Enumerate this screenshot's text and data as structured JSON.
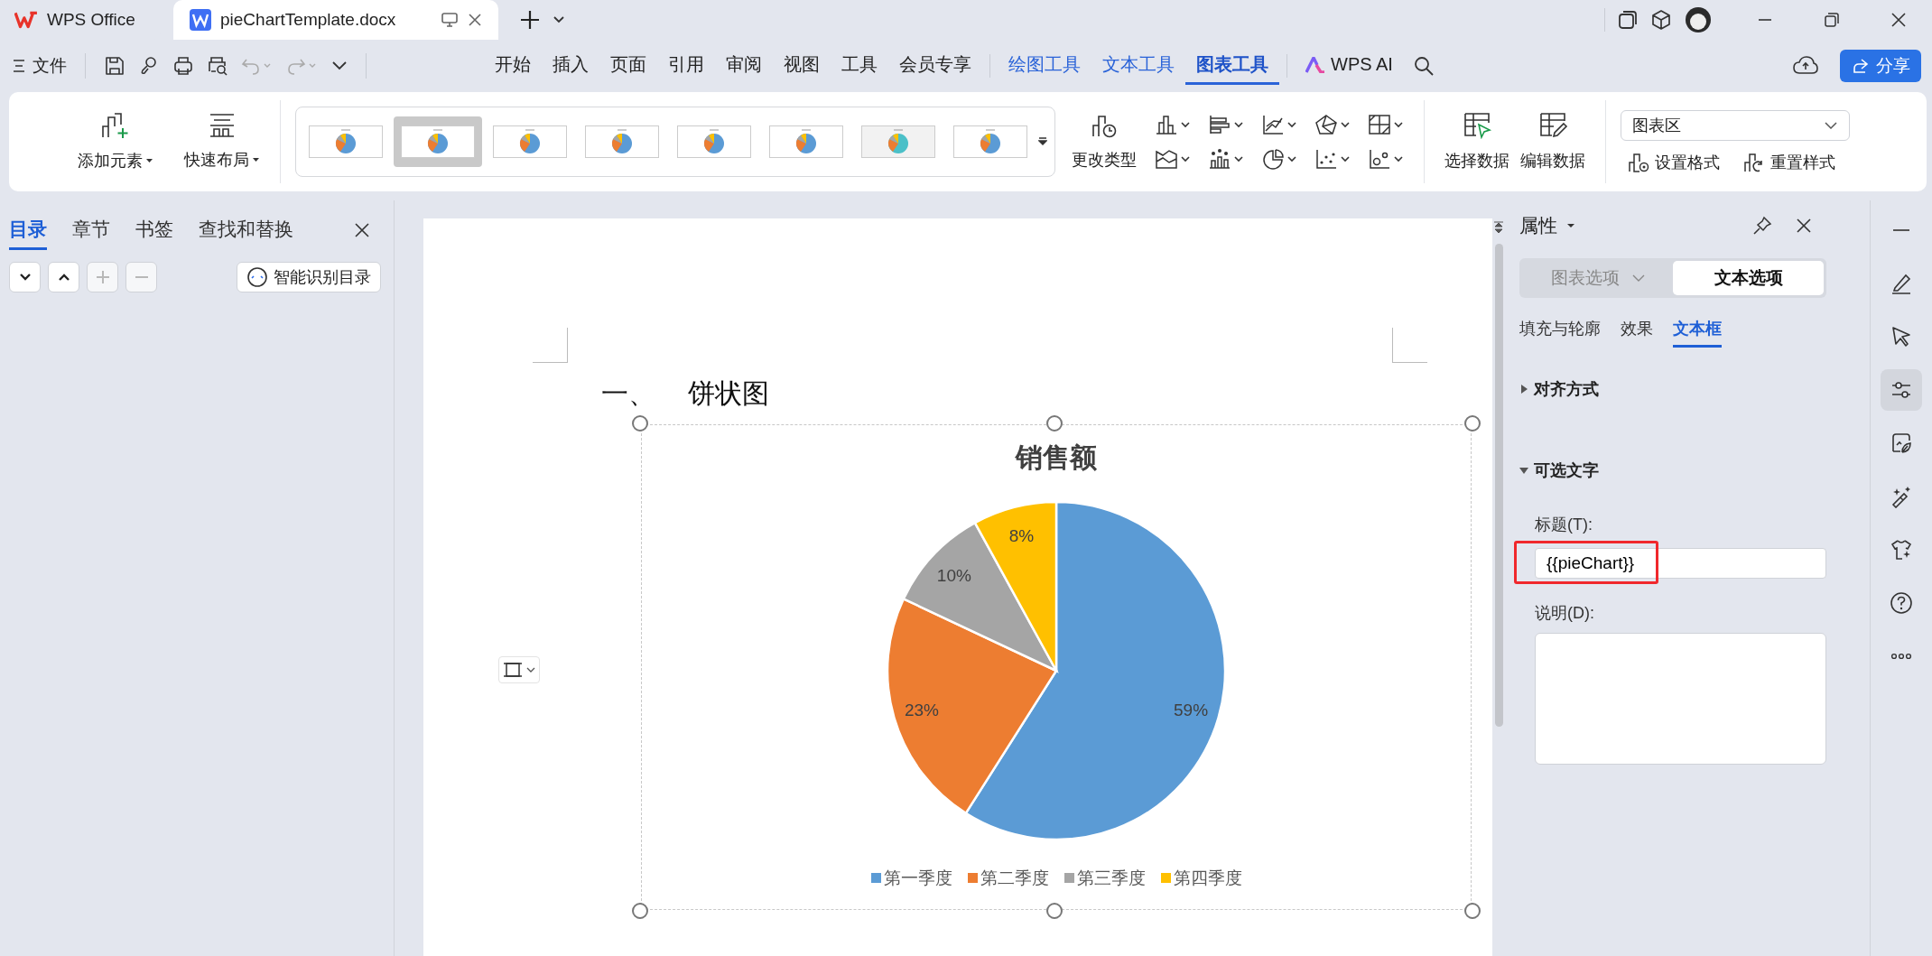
{
  "title_bar": {
    "tabs": [
      {
        "label": "WPS Office",
        "kind": "home",
        "selected": false
      },
      {
        "label": "pieChartTemplate.docx",
        "kind": "document",
        "selected": true
      }
    ]
  },
  "menu_bar": {
    "file_label": "文件",
    "items": [
      {
        "label": "开始",
        "kind": "main",
        "selected": false
      },
      {
        "label": "插入",
        "kind": "main",
        "selected": false
      },
      {
        "label": "页面",
        "kind": "main",
        "selected": false
      },
      {
        "label": "引用",
        "kind": "main",
        "selected": false
      },
      {
        "label": "审阅",
        "kind": "main",
        "selected": false
      },
      {
        "label": "视图",
        "kind": "main",
        "selected": false
      },
      {
        "label": "工具",
        "kind": "main",
        "selected": false
      },
      {
        "label": "会员专享",
        "kind": "main",
        "selected": false
      },
      {
        "label": "绘图工具",
        "kind": "tool",
        "selected": false
      },
      {
        "label": "文本工具",
        "kind": "tool",
        "selected": false
      },
      {
        "label": "图表工具",
        "kind": "tool",
        "selected": true
      },
      {
        "label": "WPS AI",
        "kind": "ai",
        "selected": false
      }
    ],
    "share_label": "分享"
  },
  "ribbon": {
    "layout_buttons": [
      {
        "label": "添加元素",
        "kind": "add"
      },
      {
        "label": "快速布局",
        "kind": "layout"
      }
    ],
    "chart_styles": [
      {
        "selected": false
      },
      {
        "selected": true
      },
      {
        "selected": false
      },
      {
        "selected": false
      },
      {
        "selected": false
      },
      {
        "selected": false
      },
      {
        "selected": false
      },
      {
        "selected": false
      }
    ],
    "change_type_label": "更改类型",
    "data_buttons": [
      {
        "label": "选择数据",
        "kind": "select"
      },
      {
        "label": "编辑数据",
        "kind": "edit"
      }
    ],
    "element_select": {
      "value": "图表区"
    },
    "format_buttons": [
      {
        "label": "设置格式",
        "kind": "format"
      },
      {
        "label": "重置样式",
        "kind": "reset"
      }
    ]
  },
  "left_panel": {
    "tabs": [
      {
        "label": "目录",
        "selected": true
      },
      {
        "label": "章节",
        "selected": false
      },
      {
        "label": "书签",
        "selected": false
      },
      {
        "label": "查找和替换",
        "selected": false
      }
    ],
    "nav_buttons": [
      {
        "kind": "down",
        "disabled": false
      },
      {
        "kind": "up",
        "disabled": false
      },
      {
        "kind": "add",
        "disabled": true
      },
      {
        "kind": "remove",
        "disabled": true
      }
    ],
    "smart_toc_label": "智能识别目录"
  },
  "document": {
    "heading_number": "一、",
    "heading": "饼状图",
    "chart_data": {
      "type": "pie",
      "title": "销售额",
      "categories": [
        "第一季度",
        "第二季度",
        "第三季度",
        "第四季度"
      ],
      "values": [
        59,
        23,
        10,
        8
      ],
      "legend": "bottom",
      "colors": [
        "#5b9bd5",
        "#ed7d31",
        "#a5a5a5",
        "#ffc000"
      ],
      "value_labels": [
        "59%",
        "23%",
        "10%",
        "8%"
      ]
    }
  },
  "properties_panel": {
    "title": "属性",
    "option_tabs": [
      {
        "label": "图表选项",
        "selected": false
      },
      {
        "label": "文本选项",
        "selected": true
      }
    ],
    "sub_tabs": [
      {
        "label": "填充与轮廓",
        "selected": false
      },
      {
        "label": "效果",
        "selected": false
      },
      {
        "label": "文本框",
        "selected": true
      }
    ],
    "sections": [
      {
        "title": "对齐方式",
        "expanded": false
      },
      {
        "title": "可选文字",
        "expanded": true
      }
    ],
    "alt_title_label": "标题(T):",
    "alt_title_value": "{{pieChart}}",
    "alt_description_label": "说明(D):"
  },
  "side_toolbar": {
    "items": [
      {
        "kind": "minimize",
        "selected": false
      },
      {
        "kind": "pen",
        "selected": false
      },
      {
        "kind": "cursor",
        "selected": false
      },
      {
        "kind": "sliders",
        "selected": true
      },
      {
        "kind": "image",
        "selected": false
      },
      {
        "kind": "wand",
        "selected": false
      },
      {
        "kind": "shirt",
        "selected": false
      },
      {
        "kind": "help",
        "selected": false
      },
      {
        "kind": "more",
        "selected": false
      }
    ]
  }
}
